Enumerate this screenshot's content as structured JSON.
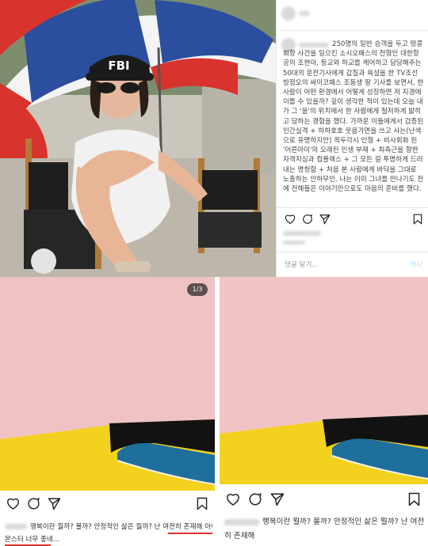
{
  "top_post": {
    "cap_label": "FBI",
    "caption_text": "250명의 일반 승객을 두고 땅콩회항 사건을 일으킨 소시오패스의 전형인 대한항공의 조현아, 등교와 하교를 케어하고 담당해주는 50대의 운전기사에게 갑질과 욕설을 한 TV조선 방정오의 싸이코패스 조동생 딸 기사를 보면서, 한 사람이 어떤 환경에서 어떻게 성장하면 저 지경에 이를 수 있을까? 깊이 생각한 적이 있는데 오늘 내가 그 '을'의 위치에서 한 사람에게 철저하게 밟히고 당하는 경험을 했다. 가까운 이들에게서 검증된 인간실격 + 하하호호 웃음가면을 쓰고 사는(난색으로 유명하지만) 꼭두각시 인형 + 비사회화 된 '어른아이'의 오래된 인생 부재 + 최측근을 향한 자격지심과 컴플렉스 + 그 모든 걸 투명하게 드러내는 명청함 + 처음 본 사람에게 바닥을 그대로 노출하는 안하무인. 나는 이미 그녀를 만나기도 전에 전해들은 이야기만으로도 마음의 준비를 했다.",
    "comment_placeholder": "댓글 달기...",
    "post_button": "게시"
  },
  "left_post": {
    "counter": "1/3",
    "caption_line1": "행복이란 뭘까? 몰까? 안정적인 삶은 뭘까? 난 여전히 존재해 아이린슬기",
    "caption_line2": "몬스터 너무 좋네..."
  },
  "right_post": {
    "caption_line1": "행복이란 뭘까? 몰까? 안정적인 삶은 뭘까? 난 여전",
    "caption_line2": "히 존재해"
  },
  "colors": {
    "painting_pink": "#f0c4c4",
    "painting_yellow": "#f2d21e",
    "painting_blue": "#1f6f9c",
    "painting_black": "#121212",
    "underline_red": "#e03030",
    "umbrella_red": "#d8332c",
    "umbrella_blue": "#2b4f9e"
  },
  "icons": [
    "heart-icon",
    "comment-icon",
    "share-icon",
    "bookmark-icon"
  ]
}
